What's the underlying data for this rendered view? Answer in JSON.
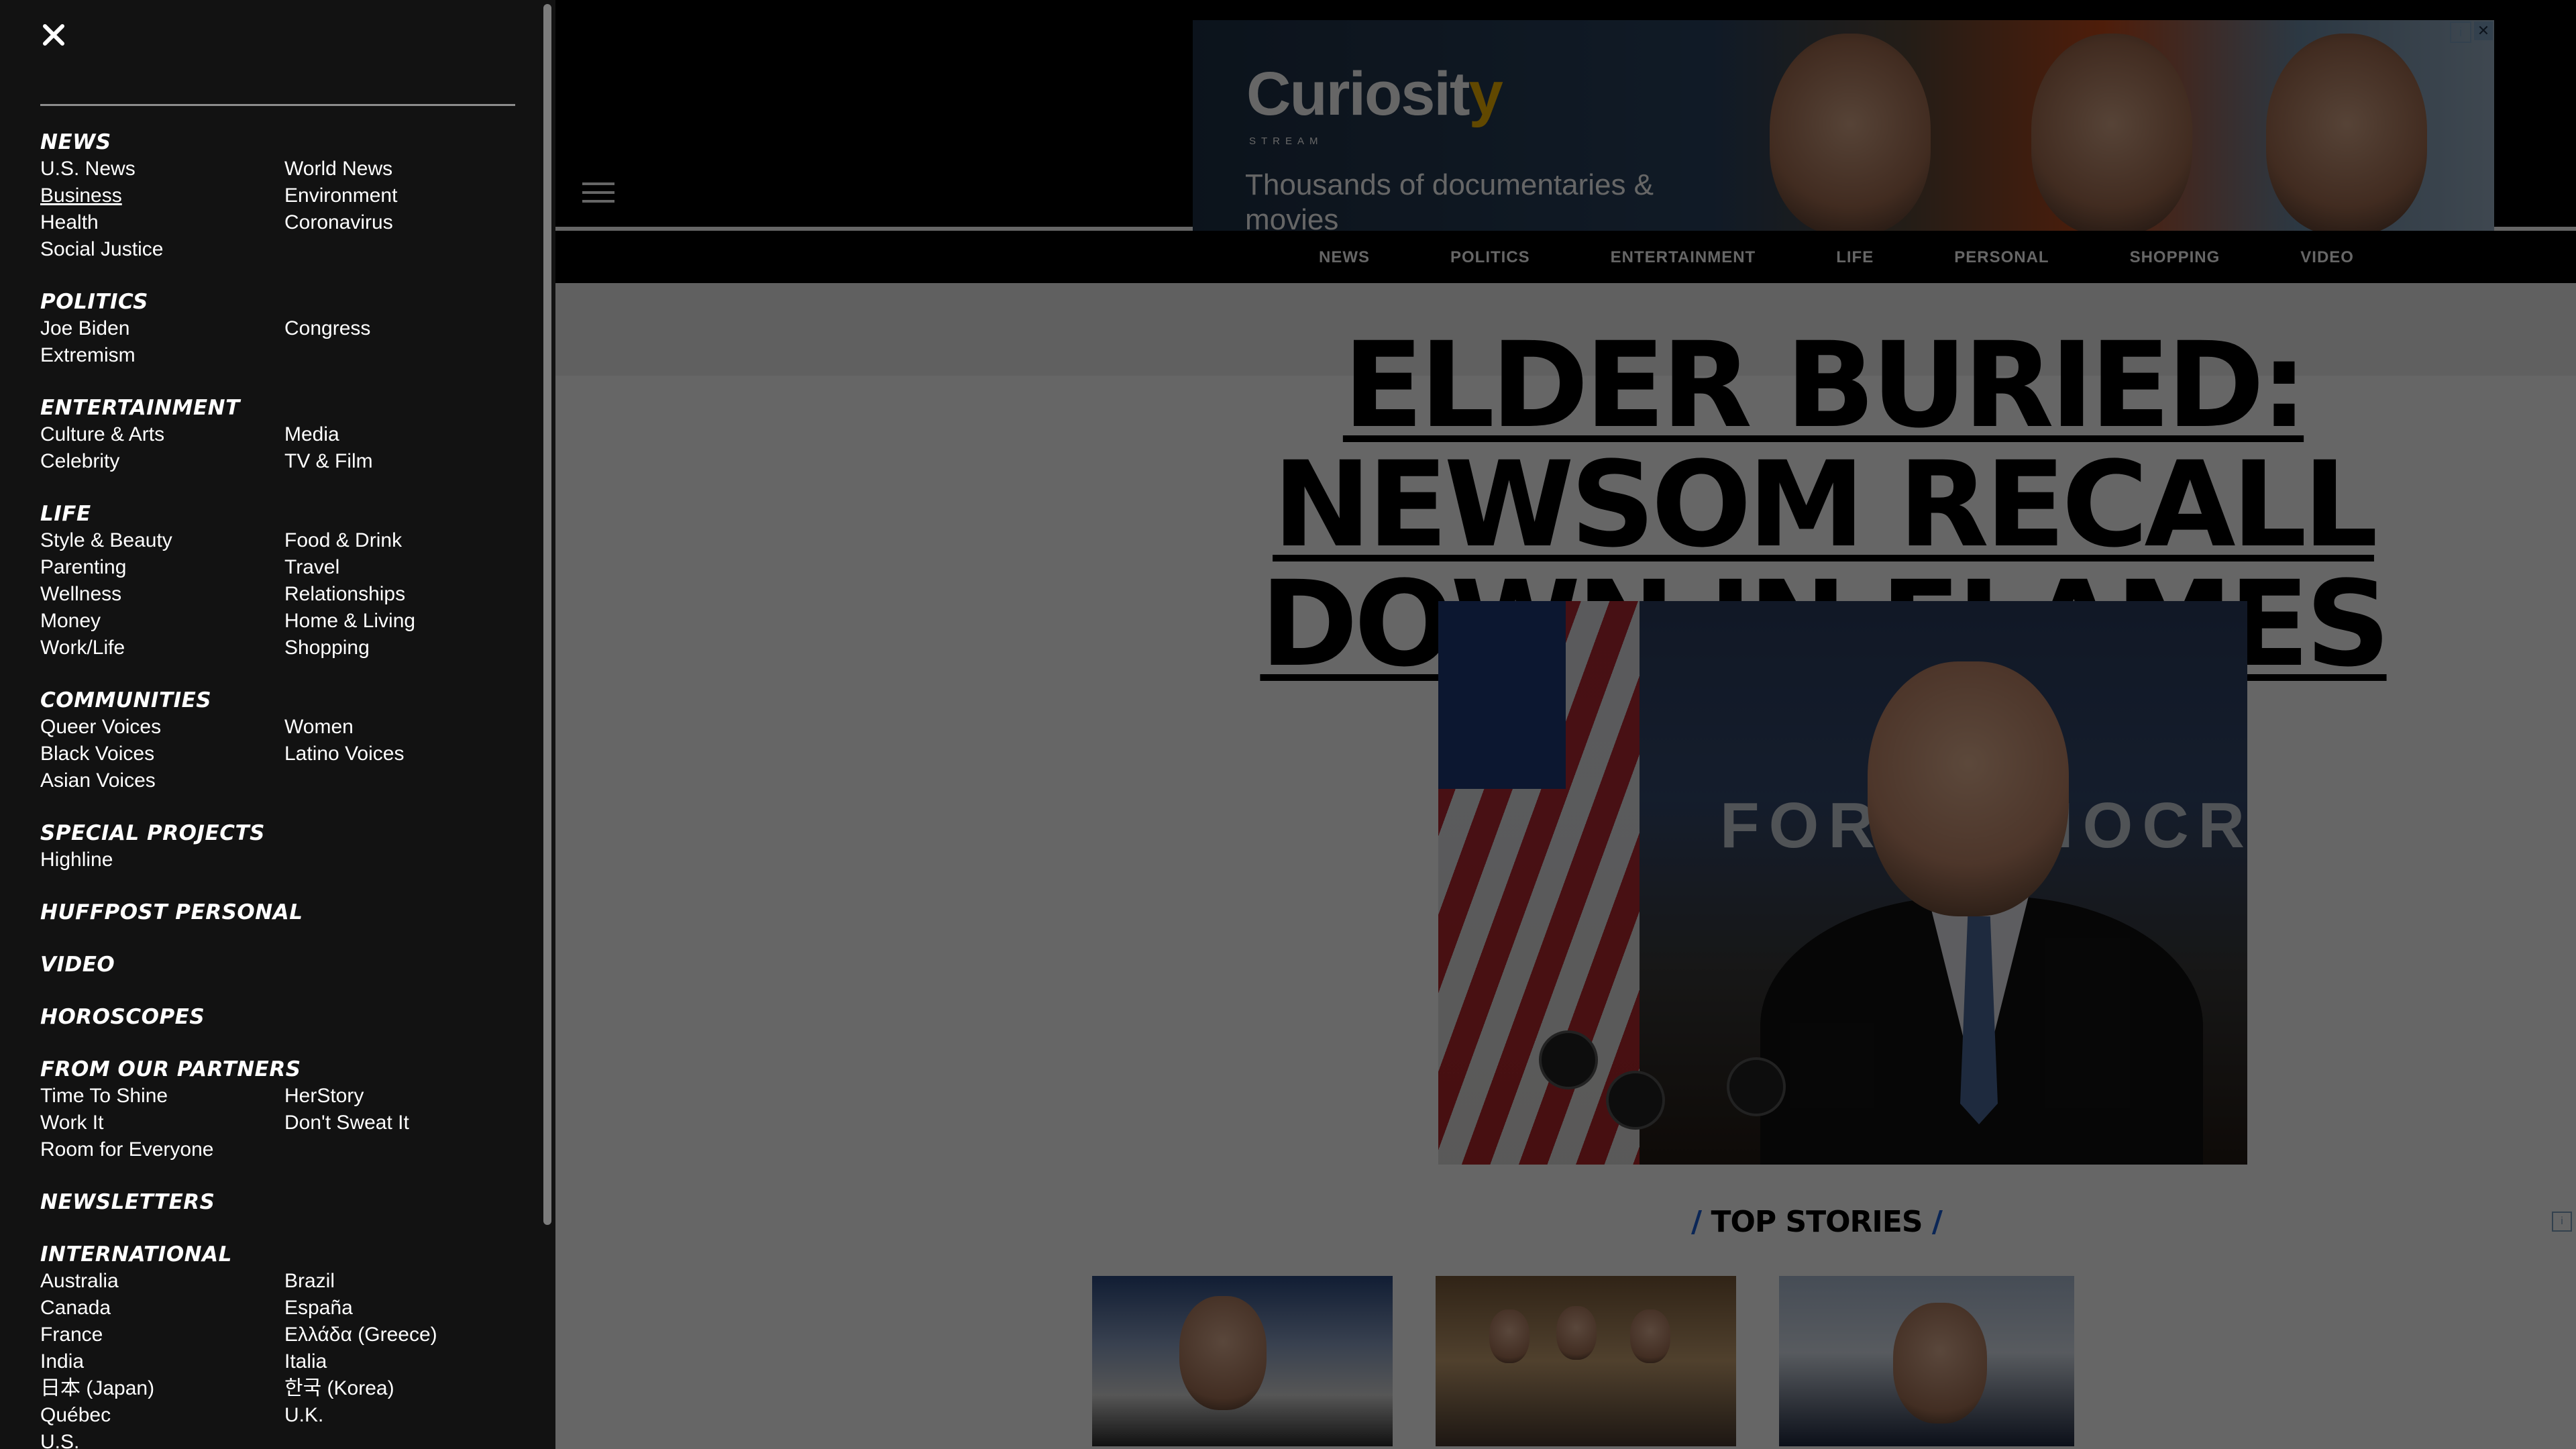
{
  "menu": {
    "close_icon": "close-icon",
    "sections": [
      {
        "title": "NEWS",
        "items": [
          "U.S. News",
          "World News",
          "Business",
          "Environment",
          "Health",
          "Coronavirus",
          "Social Justice"
        ]
      },
      {
        "title": "POLITICS",
        "items": [
          "Joe Biden",
          "Congress",
          "Extremism"
        ]
      },
      {
        "title": "ENTERTAINMENT",
        "items": [
          "Culture & Arts",
          "Media",
          "Celebrity",
          "TV & Film"
        ]
      },
      {
        "title": "LIFE",
        "items": [
          "Style & Beauty",
          "Food & Drink",
          "Parenting",
          "Travel",
          "Wellness",
          "Relationships",
          "Money",
          "Home & Living",
          "Work/Life",
          "Shopping"
        ]
      },
      {
        "title": "COMMUNITIES",
        "items": [
          "Queer Voices",
          "Women",
          "Black Voices",
          "Latino Voices",
          "Asian Voices"
        ]
      },
      {
        "title": "SPECIAL PROJECTS",
        "items": [
          "Highline"
        ]
      },
      {
        "title": "HUFFPOST PERSONAL",
        "items": []
      },
      {
        "title": "VIDEO",
        "items": []
      },
      {
        "title": "HOROSCOPES",
        "items": []
      },
      {
        "title": "FROM OUR PARTNERS",
        "items": [
          "Time To Shine",
          "HerStory",
          "Work It",
          "Don't Sweat It",
          "Room for Everyone"
        ]
      },
      {
        "title": "NEWSLETTERS",
        "items": []
      },
      {
        "title": "INTERNATIONAL",
        "items": [
          "Australia",
          "Brazil",
          "Canada",
          "España",
          "France",
          "Ελλάδα (Greece)",
          "India",
          "Italia",
          "日本 (Japan)",
          "한국 (Korea)",
          "Québec",
          "U.K.",
          "U.S."
        ]
      }
    ],
    "underlined_item": "Business"
  },
  "ad": {
    "brand_a": "Curiosit",
    "brand_b": "y",
    "brand_sub": "STREAM",
    "copy": "Thousands of documentaries & movies",
    "info_glyph": "i",
    "close_glyph": "✕"
  },
  "nav": {
    "items": [
      "NEWS",
      "POLITICS",
      "ENTERTAINMENT",
      "LIFE",
      "PERSONAL",
      "SHOPPING",
      "VIDEO"
    ]
  },
  "headline": "ELDER BURIED: NEWSOM RECALL DOWN IN FLAMES",
  "hero": {
    "banner_text": "FOR  DEMOCR"
  },
  "top_stories": {
    "slash": "/",
    "label": "TOP STORIES"
  },
  "ad_choice_glyph": "i",
  "colors": {
    "accent_blue": "#1c5fd6",
    "menu_bg": "#121212",
    "overlay": "rgba(0,0,0,0.6)"
  }
}
